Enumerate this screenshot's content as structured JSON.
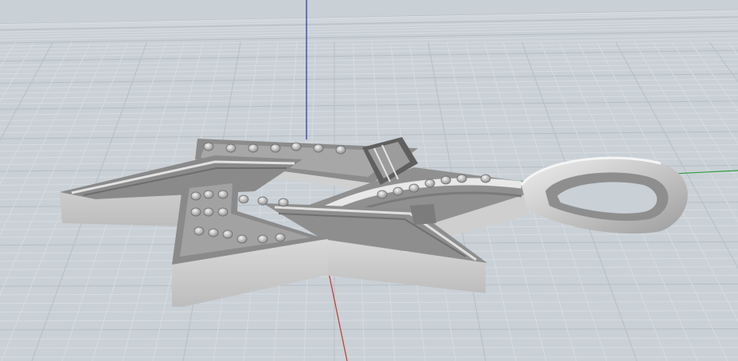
{
  "viewport": {
    "view": "perspective",
    "background": "#c9d0d6",
    "grid": {
      "minor_color": "#d6dce1",
      "major_color": "#b6bec5"
    },
    "axes": {
      "x_color": "#c0392b",
      "y_color": "#2e9e3a",
      "z_color": "#2f2fb0"
    }
  },
  "model": {
    "object": "star-pendant",
    "material_color": "#b9b9b9",
    "shade_dark": "#6f6f6f",
    "shade_light": "#e6e6e6"
  }
}
